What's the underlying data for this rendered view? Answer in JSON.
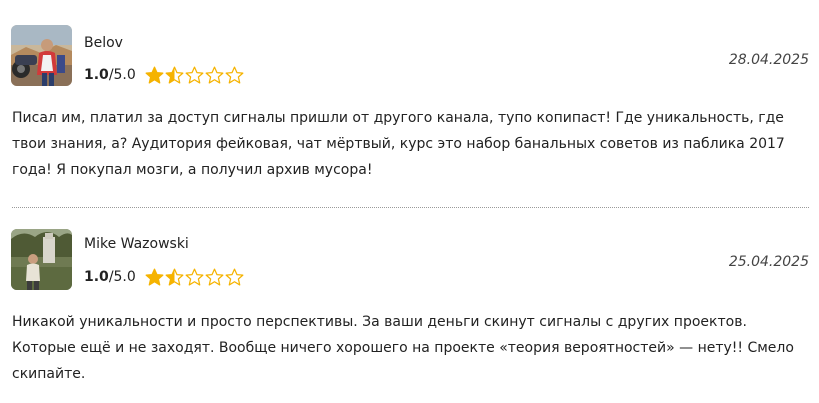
{
  "colors": {
    "star_fill": "#f5b301",
    "star_outline": "#f5b301",
    "divider": "#9a9a9a"
  },
  "reviews": [
    {
      "author": "Belov",
      "score": "1.0",
      "score_max": "/5.0",
      "stars_filled": 1.5,
      "stars_total": 5,
      "date": "28.04.2025",
      "text": "Писал им, платил за доступ сигналы пришли от другого канала, тупо копипаст! Где уникальность, где твои знания, а? Аудитория фейковая, чат мёртвый, курс это набор банальных советов из паблика 2017 года! Я покупал мозги, а получил архив мусора!",
      "avatar_icon": "user-photo-motorcyclist"
    },
    {
      "author": "Mike Wazowski",
      "score": "1.0",
      "score_max": "/5.0",
      "stars_filled": 1.5,
      "stars_total": 5,
      "date": "25.04.2025",
      "text": "Никакой уникальности и просто перспективы. За ваши деньги скинут сигналы с других проектов. Которые ещё и не заходят. Вообще ничего хорошего на проекте «теория вероятностей» — нету!! Смело скипайте.",
      "avatar_icon": "user-photo-outdoor"
    }
  ]
}
